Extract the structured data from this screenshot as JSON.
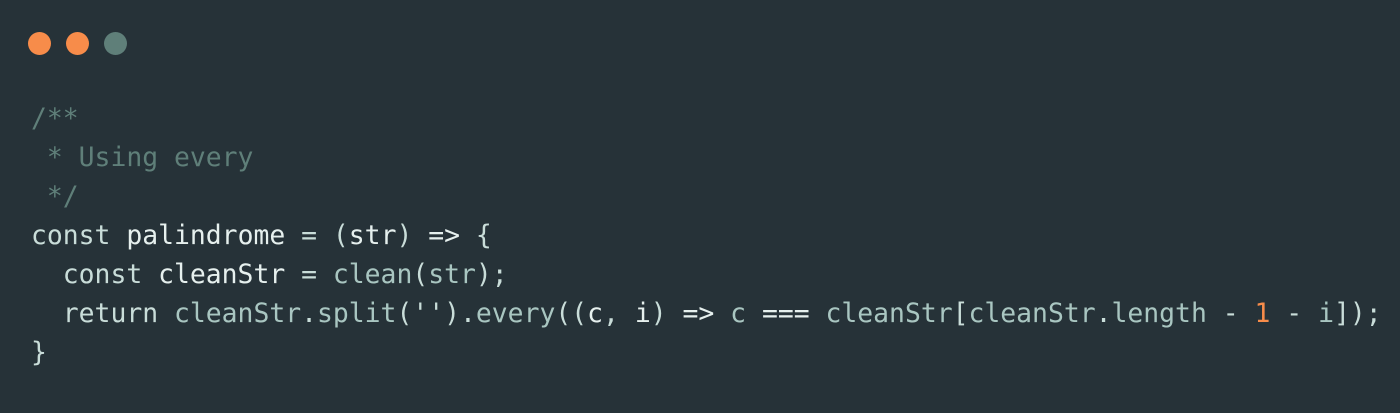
{
  "window_controls": [
    {
      "name": "close",
      "color": "#f78c4a"
    },
    {
      "name": "minimize",
      "color": "#f78c4a"
    },
    {
      "name": "maximize",
      "color": "#5f7f79"
    }
  ],
  "code": {
    "language": "javascript",
    "lines": [
      [
        [
          "/**",
          "comment"
        ]
      ],
      [
        [
          " * Using every",
          "comment"
        ]
      ],
      [
        [
          " */",
          "comment"
        ]
      ],
      [
        [
          "const ",
          "keyword"
        ],
        [
          "palindrome",
          "ident"
        ],
        [
          " = (",
          "punc"
        ],
        [
          "str",
          "ident"
        ],
        [
          ") ",
          "punc"
        ],
        [
          "=>",
          "op"
        ],
        [
          " {",
          "punc"
        ]
      ],
      [
        [
          "  const ",
          "keyword"
        ],
        [
          "cleanStr",
          "ident"
        ],
        [
          " = ",
          "punc"
        ],
        [
          "clean",
          "fn"
        ],
        [
          "(",
          "punc"
        ],
        [
          "str",
          "fn"
        ],
        [
          ");",
          "punc"
        ]
      ],
      [
        [
          "  return ",
          "keyword"
        ],
        [
          "cleanStr",
          "fn"
        ],
        [
          ".",
          "punc"
        ],
        [
          "split",
          "fn"
        ],
        [
          "('').",
          "punc"
        ],
        [
          "every",
          "fn"
        ],
        [
          "((",
          "punc"
        ],
        [
          "c",
          "ident"
        ],
        [
          ", ",
          "punc"
        ],
        [
          "i",
          "ident"
        ],
        [
          ") ",
          "punc"
        ],
        [
          "=>",
          "op"
        ],
        [
          " ",
          "punc"
        ],
        [
          "c",
          "fn"
        ],
        [
          " ",
          "punc"
        ],
        [
          "===",
          "op"
        ],
        [
          " ",
          "punc"
        ],
        [
          "cleanStr",
          "fn"
        ],
        [
          "[",
          "punc"
        ],
        [
          "cleanStr",
          "fn"
        ],
        [
          ".",
          "punc"
        ],
        [
          "length",
          "fn"
        ],
        [
          " - ",
          "punc"
        ],
        [
          "1",
          "num"
        ],
        [
          " - ",
          "punc"
        ],
        [
          "i",
          "fn"
        ],
        [
          "]);",
          "punc"
        ]
      ],
      [
        [
          "}",
          "punc"
        ]
      ]
    ]
  }
}
